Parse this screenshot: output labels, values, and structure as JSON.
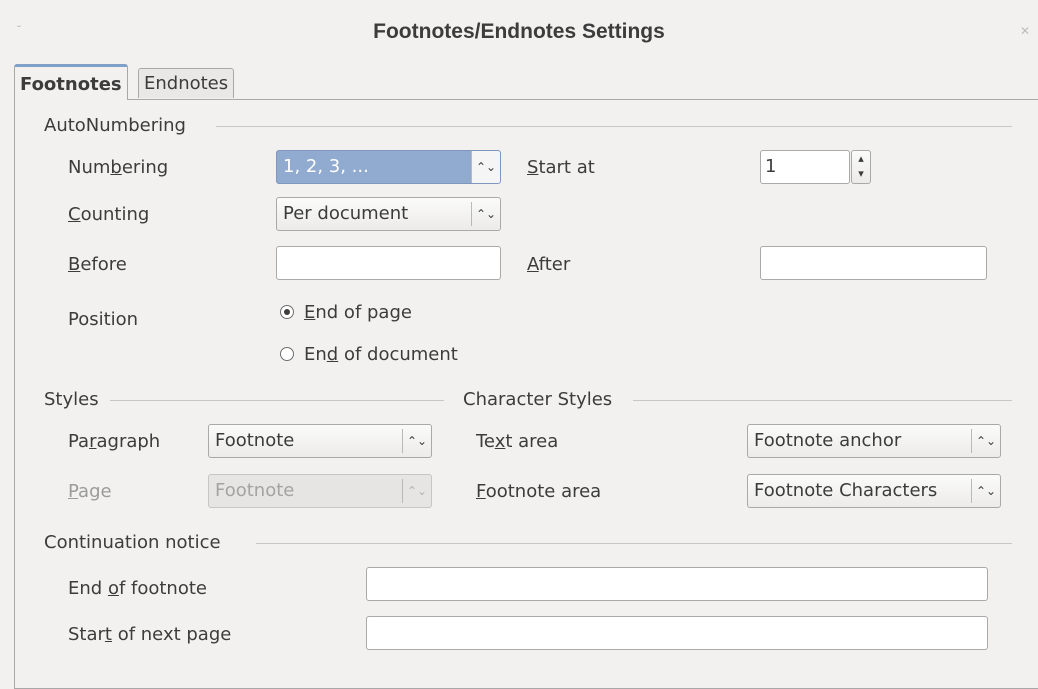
{
  "window": {
    "title": "Footnotes/Endnotes Settings",
    "left_button_glyph": "˘",
    "right_button_glyph": "✕"
  },
  "tabs": [
    {
      "label": "Footnotes",
      "active": true
    },
    {
      "label": "Endnotes",
      "active": false
    }
  ],
  "autonumbering": {
    "heading": "AutoNumbering",
    "numbering": {
      "label_pre": "Num",
      "label_key": "b",
      "label_post": "ering",
      "value": "1, 2, 3, ..."
    },
    "start_at": {
      "label_key": "S",
      "label_post": "tart at",
      "value": "1"
    },
    "counting": {
      "label_key": "C",
      "label_post": "ounting",
      "value": "Per document"
    },
    "before": {
      "label_key": "B",
      "label_post": "efore",
      "value": ""
    },
    "after": {
      "label_key": "A",
      "label_post": "fter",
      "value": ""
    },
    "position": {
      "label": "Position",
      "options": [
        {
          "label_key": "E",
          "label_post": "nd of page",
          "checked": true
        },
        {
          "label_pre": "En",
          "label_key": "d",
          "label_post": " of document",
          "checked": false
        }
      ]
    }
  },
  "styles": {
    "heading": "Styles",
    "paragraph": {
      "label_pre": "Pa",
      "label_key": "r",
      "label_post": "agraph",
      "value": "Footnote"
    },
    "page": {
      "label_key": "P",
      "label_post": "age",
      "value": "Footnote",
      "disabled": true
    }
  },
  "character_styles": {
    "heading": "Character Styles",
    "text_area": {
      "label_pre": "Te",
      "label_key": "x",
      "label_post": "t area",
      "value": "Footnote anchor"
    },
    "footnote_area": {
      "label_key": "F",
      "label_post": "ootnote area",
      "value": "Footnote Characters"
    }
  },
  "continuation_notice": {
    "heading": "Continuation notice",
    "end_of_footnote": {
      "label_pre": "End ",
      "label_key": "o",
      "label_post": "f footnote",
      "value": ""
    },
    "start_of_next_page": {
      "label_pre": "Star",
      "label_key": "t",
      "label_post": " of next page",
      "value": ""
    }
  },
  "icons": {
    "combo_arrow": "⌃⌄",
    "spin_up": "▴",
    "spin_down": "▾"
  },
  "colors": {
    "selection": "#90aad0",
    "tab_accent": "#7fa0c8",
    "background": "#f2f1f0"
  }
}
